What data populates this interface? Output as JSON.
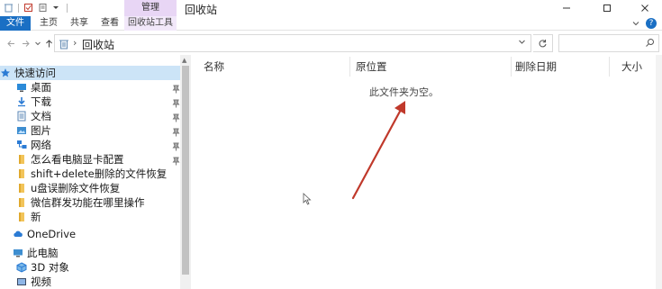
{
  "window": {
    "title": "回收站",
    "contextual_group": "管理"
  },
  "ribbon": {
    "tabs": [
      "文件",
      "主页",
      "共享",
      "查看",
      "回收站工具"
    ]
  },
  "address": {
    "path": "回收站",
    "search_placeholder": ""
  },
  "nav": {
    "quick_access": "快速访问",
    "pinned": [
      {
        "label": "桌面",
        "icon": "desktop-icon"
      },
      {
        "label": "下载",
        "icon": "download-icon"
      },
      {
        "label": "文档",
        "icon": "documents-icon"
      },
      {
        "label": "图片",
        "icon": "pictures-icon"
      },
      {
        "label": "网络",
        "icon": "network-icon"
      },
      {
        "label": "怎么看电脑显卡配置",
        "icon": "folder-icon"
      }
    ],
    "recent": [
      {
        "label": "shift+delete删除的文件恢复",
        "icon": "folder-icon"
      },
      {
        "label": "u盘误删除文件恢复",
        "icon": "folder-icon"
      },
      {
        "label": "微信群发功能在哪里操作",
        "icon": "folder-icon"
      },
      {
        "label": "新",
        "icon": "folder-icon"
      }
    ],
    "onedrive": "OneDrive",
    "this_pc": "此电脑",
    "pc_items": [
      {
        "label": "3D 对象",
        "icon": "3d-objects-icon"
      },
      {
        "label": "视频",
        "icon": "videos-icon"
      }
    ]
  },
  "content": {
    "columns": [
      "名称",
      "原位置",
      "删除日期",
      "大小"
    ],
    "empty_message": "此文件夹为空。"
  },
  "colors": {
    "file_tab": "#1a6fc4",
    "manage_tab": "#e8d6f5",
    "selected_nav": "#cce4f7",
    "annotation_arrow": "#c0392b"
  }
}
